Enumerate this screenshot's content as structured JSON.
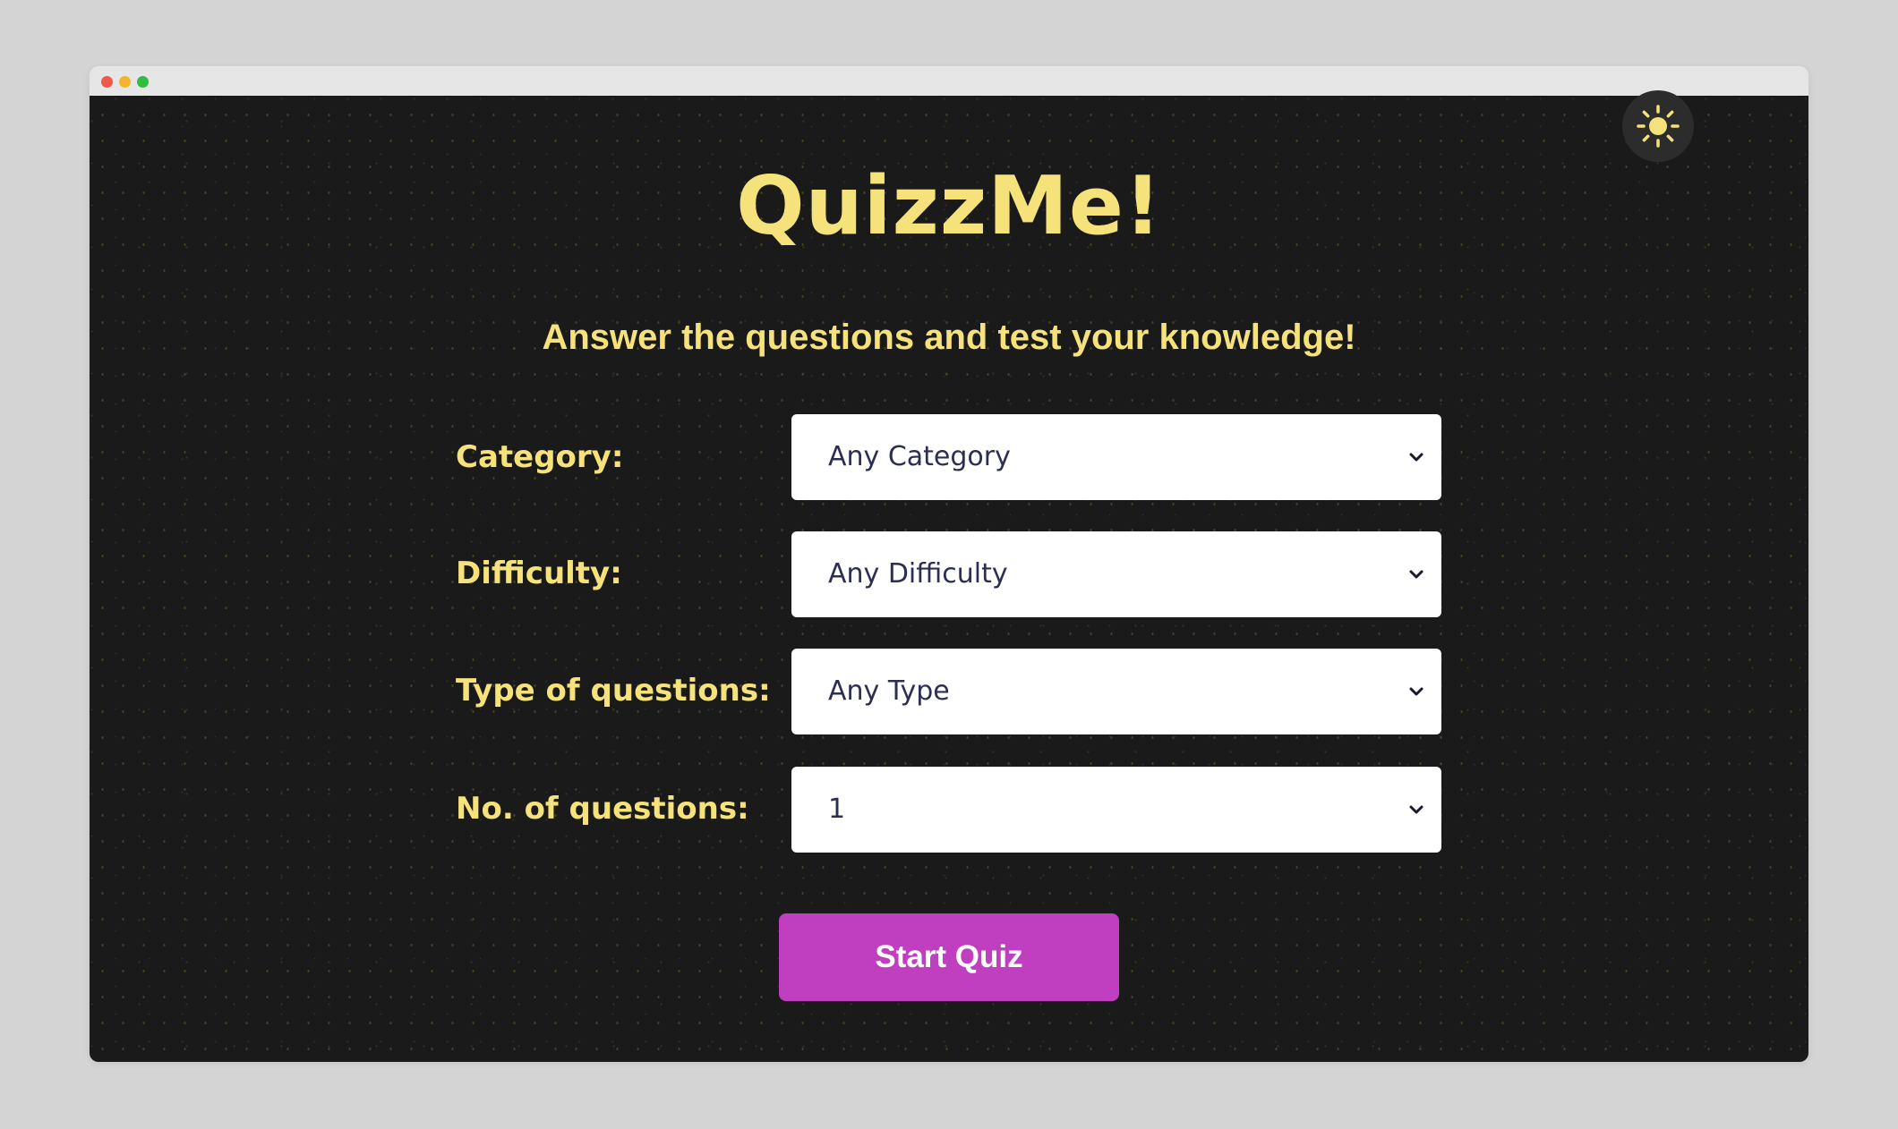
{
  "window": {
    "controls": [
      "close",
      "minimize",
      "maximize"
    ]
  },
  "theme_toggle": {
    "icon": "sun-icon",
    "color": "#f6e27a"
  },
  "header": {
    "title": "QuizzMe!",
    "subtitle": "Answer the questions and test your knowledge!"
  },
  "form": {
    "fields": [
      {
        "label": "Category:",
        "value": "Any Category"
      },
      {
        "label": "Difficulty:",
        "value": "Any Difficulty"
      },
      {
        "label": "Type of questions:",
        "value": "Any Type"
      },
      {
        "label": "No. of questions:",
        "value": "1"
      }
    ],
    "submit_label": "Start Quiz"
  },
  "colors": {
    "background": "#1b1a1a",
    "accent_text": "#f6e27a",
    "button": "#c03ec0",
    "select_text": "#2c2f52"
  }
}
